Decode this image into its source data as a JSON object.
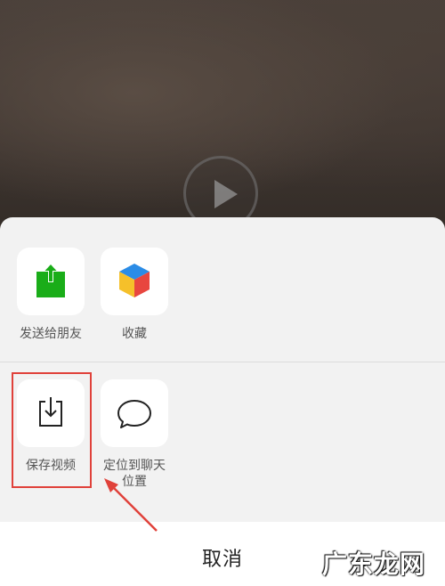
{
  "background": {
    "type": "video",
    "play_icon": "play-icon"
  },
  "share_sheet": {
    "row_1": [
      {
        "label": "发送给朋友",
        "icon": "share-arrow-icon",
        "icon_color": "#1aad19"
      },
      {
        "label": "收藏",
        "icon": "cube-icon",
        "icon_colors": [
          "#2b8ce6",
          "#f5c02a",
          "#e8463f"
        ]
      }
    ],
    "row_2": [
      {
        "label": "保存视频",
        "icon": "download-icon"
      },
      {
        "label_line1": "定位到聊天",
        "label_line2": "位置",
        "icon": "chat-bubble-icon"
      }
    ],
    "cancel_label": "取消"
  },
  "annotation": {
    "highlight_color": "#e0413a",
    "target": "保存视频"
  },
  "watermark": "广东龙网"
}
